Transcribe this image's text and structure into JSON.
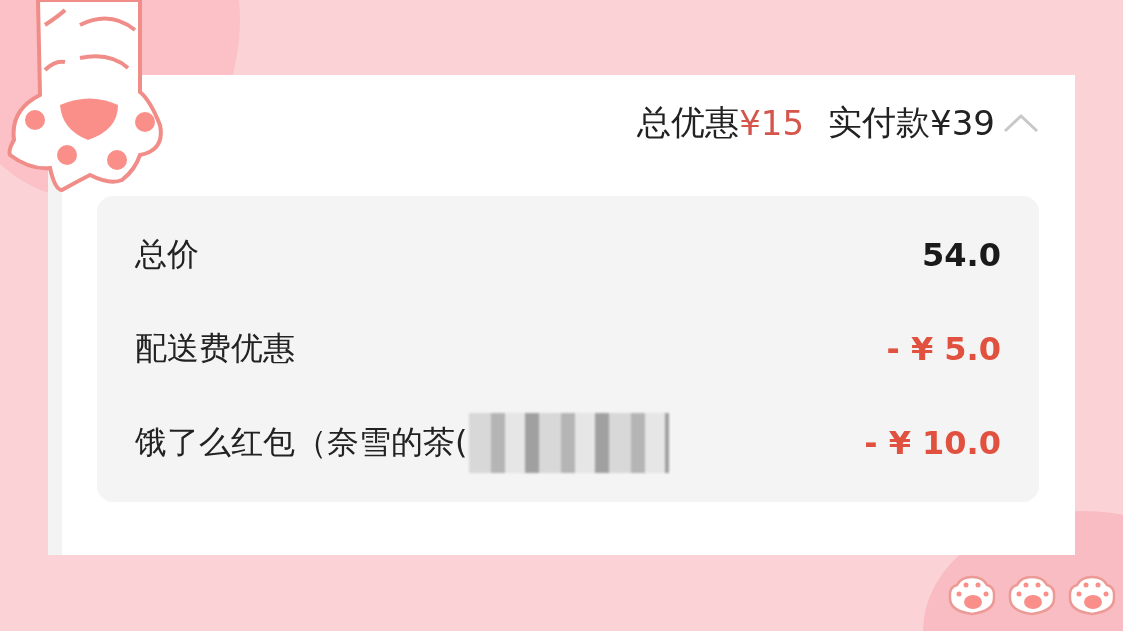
{
  "summary": {
    "discount_label": "总优惠",
    "discount_amount": "¥15",
    "paid_label": "实付款",
    "paid_amount": "¥39",
    "expanded": true
  },
  "breakdown": [
    {
      "label": "总价",
      "amount": "54.0",
      "kind": "price",
      "redacted": false
    },
    {
      "label": "配送费优惠",
      "amount": "- ¥ 5.0",
      "kind": "discount",
      "redacted": false
    },
    {
      "label": "饿了么红包（奈雪的茶(",
      "amount": "- ¥ 10.0",
      "kind": "discount",
      "redacted": true
    }
  ]
}
